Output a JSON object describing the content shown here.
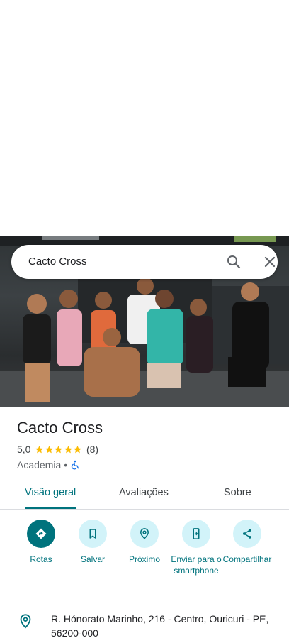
{
  "search": {
    "query": "Cacto Cross"
  },
  "place": {
    "name": "Cacto Cross",
    "rating": "5,0",
    "stars": 5,
    "review_count": "(8)",
    "category": "Academia",
    "separator": "•"
  },
  "tabs": [
    {
      "label": "Visão geral",
      "active": true
    },
    {
      "label": "Avaliações",
      "active": false
    },
    {
      "label": "Sobre",
      "active": false
    }
  ],
  "actions": [
    {
      "label": "Rotas",
      "icon": "directions-icon"
    },
    {
      "label": "Salvar",
      "icon": "bookmark-icon"
    },
    {
      "label": "Próximo",
      "icon": "nearby-icon"
    },
    {
      "label": "Enviar para o smartphone",
      "icon": "send-to-phone-icon"
    },
    {
      "label": "Compartilhar",
      "icon": "share-icon"
    }
  ],
  "address": {
    "text": "R. Hónorato Marinho, 216 - Centro, Ouricuri - PE, 56200-000"
  },
  "colors": {
    "accent": "#00737d",
    "accent_light": "#d2f3f9",
    "star": "#fbbc04"
  }
}
